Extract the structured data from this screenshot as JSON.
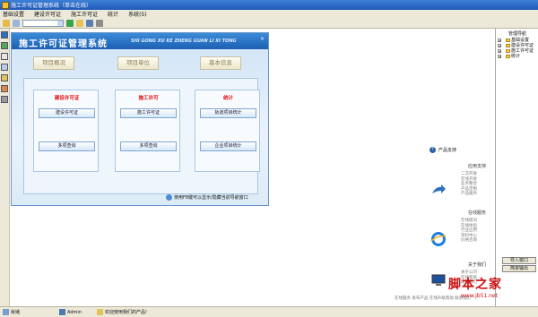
{
  "window": {
    "title": "施工许可证管理系统（单击在线）"
  },
  "menu": [
    "基础设置",
    "建设许可证",
    "施工许可证",
    "统计",
    "系统(S)"
  ],
  "colors": {
    "titlebar": "#1f58b8",
    "panel_header": "#1d5fb2",
    "group_title": "#e01010",
    "watermark": "#cc1010"
  },
  "panel": {
    "title": "施工许可证管理系统",
    "subtitle": "SHI GONG XU KE ZHENG GUAN LI XI TONG",
    "close_glyph": "×",
    "tabs": [
      "项目概况",
      "项目单位",
      "基本信息"
    ],
    "groups": [
      {
        "title": "建设许可证",
        "buttons": [
          "建设许可证",
          "多项查询"
        ]
      },
      {
        "title": "施工许可",
        "buttons": [
          "施工许可证",
          "多项查询"
        ]
      },
      {
        "title": "统计",
        "buttons": [
          "轨道项目统计",
          "企业项目统计"
        ]
      }
    ],
    "toggle_hint": "使用F8键可以显示/隐藏当前导航窗口"
  },
  "promo": {
    "header": "产品支持",
    "sections": [
      {
        "title": "应用支持",
        "items": [
          "二次开发",
          "在线开发",
          "业务整合",
          "产品定制",
          "产品服务"
        ]
      },
      {
        "title": "在线服务",
        "items": [
          "在线提问",
          "在线体验",
          "行业应用",
          "资料中心",
          "价格咨询"
        ]
      },
      {
        "title": "关于我们",
        "items": [
          "关于公司",
          "在线帮助",
          "联系我们"
        ]
      }
    ],
    "bottom_link": "在线服务  发布产品  在线升级帮助  联系我们"
  },
  "tree": {
    "title": "管理导航",
    "items": [
      "基础设置",
      "建设许可证",
      "施工许可证",
      "统计"
    ],
    "expander_glyph": "+",
    "buttons": [
      "导入窗口",
      "简单输出"
    ]
  },
  "watermark": {
    "text": "脚本之家",
    "url": "www.jb51.net"
  },
  "status": {
    "ready": "就绪",
    "user": "Admin",
    "welcome": "欢迎使用我们的产品!"
  }
}
